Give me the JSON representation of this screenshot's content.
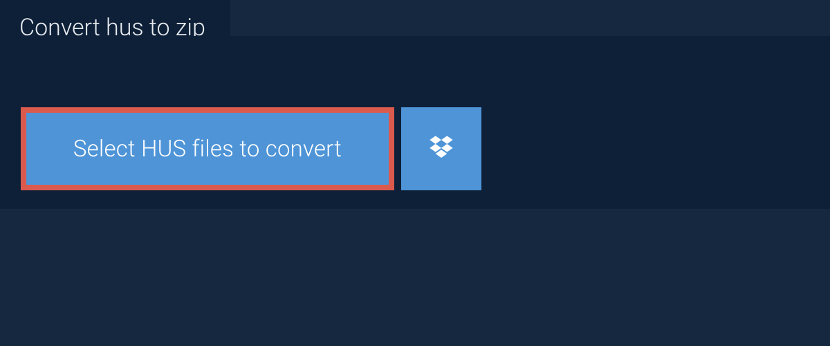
{
  "header": {
    "tab_label": "Convert hus to zip"
  },
  "actions": {
    "select_files_label": "Select HUS files to convert",
    "dropbox_icon": "dropbox-icon"
  },
  "colors": {
    "page_bg": "#15283f",
    "panel_bg": "#0e2038",
    "button_bg": "#4e94d7",
    "button_highlight_border": "#db5a4e",
    "text_light": "#e7ebef",
    "text_white": "#ffffff"
  }
}
